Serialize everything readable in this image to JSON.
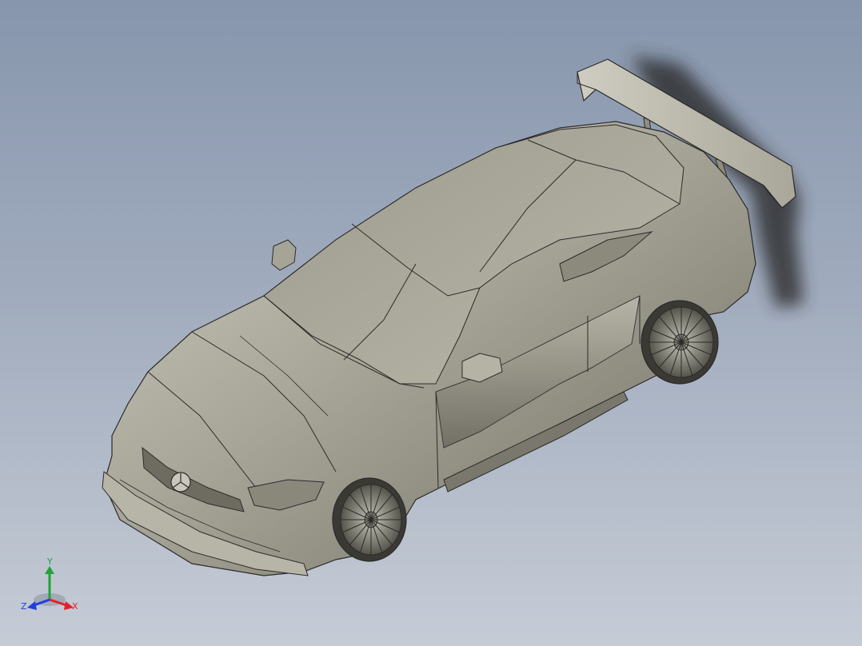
{
  "viewport": {
    "background_top": "#8796ad",
    "background_bottom": "#c6ccd6",
    "model": {
      "description_icon": "car-model",
      "body_color": "#a6a496",
      "edge_color": "#2b2b2b"
    }
  },
  "triad": {
    "x_label": "X",
    "y_label": "Y",
    "z_label": "Z",
    "x_color": "#e0222a",
    "y_color": "#1fa33a",
    "z_color": "#1f3fe0"
  }
}
